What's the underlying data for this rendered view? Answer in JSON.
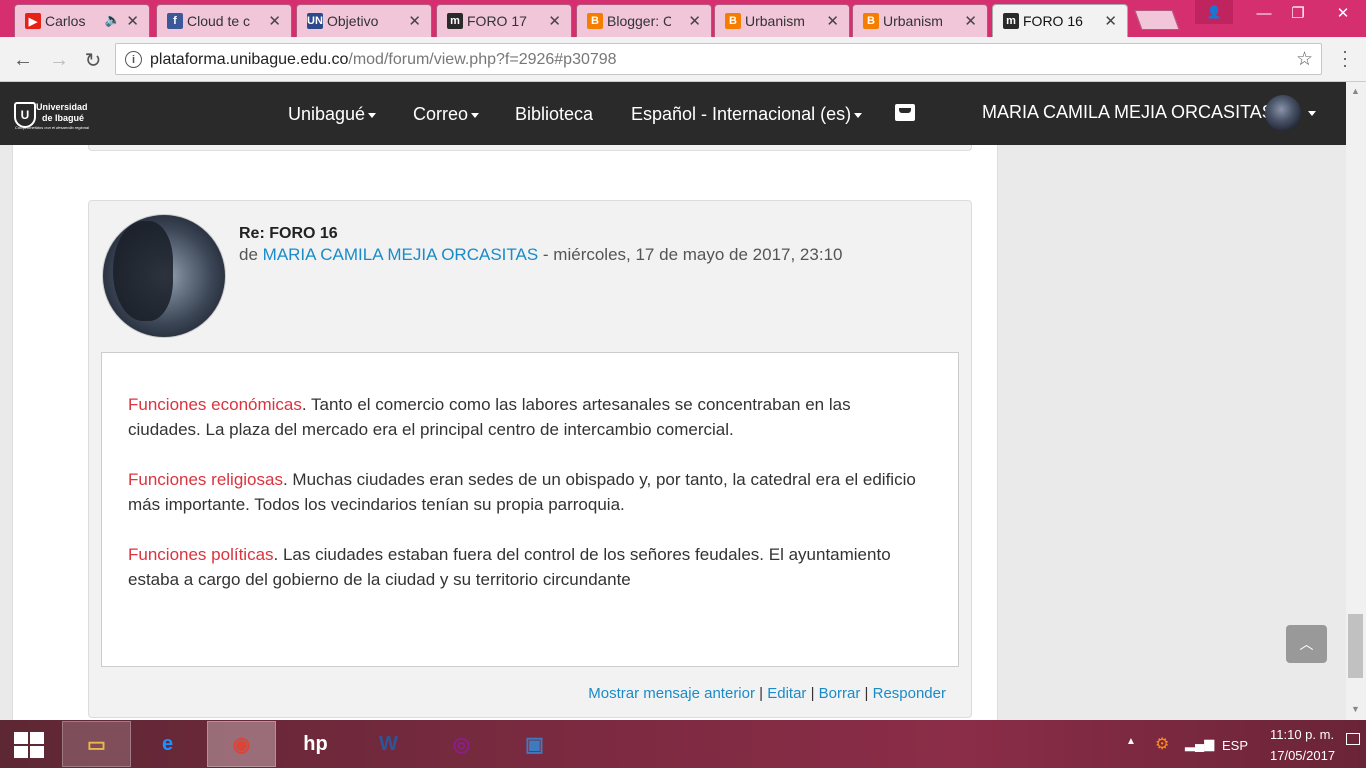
{
  "browser": {
    "tabs": [
      {
        "title": "Carlos",
        "favicon": "youtube-icon",
        "color": "#e62117",
        "glyph": "▶",
        "audio": true
      },
      {
        "title": "Cloud te c",
        "favicon": "facebook-icon",
        "color": "#3b5998",
        "glyph": "f"
      },
      {
        "title": "Objetivo",
        "favicon": "un-icon",
        "color": "#2c4a8a",
        "glyph": "UN"
      },
      {
        "title": "FORO 17",
        "favicon": "moodle-icon",
        "color": "#2a2a2a",
        "glyph": "m"
      },
      {
        "title": "Blogger: C",
        "favicon": "blogger-icon",
        "color": "#f57d00",
        "glyph": "B"
      },
      {
        "title": "Urbanism",
        "favicon": "blogger-icon",
        "color": "#f57d00",
        "glyph": "B"
      },
      {
        "title": "Urbanism",
        "favicon": "blogger-icon",
        "color": "#f57d00",
        "glyph": "B"
      },
      {
        "title": "FORO 16",
        "favicon": "moodle-icon",
        "color": "#2a2a2a",
        "glyph": "m",
        "active": true
      }
    ],
    "close_glyph": "✕",
    "url_host": "plataforma.unibague.edu.co",
    "url_path": "/mod/forum/view.php?f=2926#p30798",
    "back_icon": "←",
    "forward_icon": "→",
    "reload_icon": "↻",
    "star_icon": "☆",
    "min_icon": "—",
    "max_icon": "❐",
    "close_icon": "✕"
  },
  "site": {
    "logo_line1": "Universidad",
    "logo_line2": "de Ibagué",
    "logo_tagline": "Comprometidos con el desarrollo regional",
    "nav": {
      "unibague": "Unibagué",
      "correo": "Correo",
      "biblioteca": "Biblioteca",
      "language": "Español - Internacional (es)"
    },
    "user_name": "MARIA CAMILA MEJIA ORCASITAS"
  },
  "post": {
    "subject": "Re: FORO 16",
    "by_prefix": "de",
    "author": "MARIA CAMILA MEJIA ORCASITAS",
    "date": " - miércoles, 17 de mayo de 2017, 23:10",
    "paragraphs": [
      {
        "heading": "Funciones económicas",
        "text": ". Tanto el comercio como las labores artesanales se concentraban en las ciudades. La plaza del mercado era el principal centro de intercambio comercial."
      },
      {
        "heading": "Funciones religiosas",
        "text": ". Muchas ciudades eran sedes de un obispado y, por tanto, la catedral era el edificio más importante. Todos los vecindarios tenían su propia parroquia."
      },
      {
        "heading": "Funciones políticas",
        "text": ". Las ciudades estaban fuera del control de los señores feudales. El ayuntamiento estaba a cargo del gobierno de la ciudad y su territorio circundante"
      }
    ],
    "commands": {
      "show_parent": "Mostrar mensaje anterior",
      "edit": "Editar",
      "delete": "Borrar",
      "reply": "Responder",
      "separator": "|"
    },
    "accent_color": "#d9343f",
    "link_color": "#1a8bc8"
  },
  "taskbar": {
    "apps": [
      {
        "name": "file-explorer",
        "glyph": "▭",
        "color": "#e8b84a"
      },
      {
        "name": "internet-explorer",
        "glyph": "e",
        "color": "#1e90ff"
      },
      {
        "name": "chrome",
        "glyph": "◉",
        "color": "#db4437"
      },
      {
        "name": "hp",
        "glyph": "hp",
        "color": "#ffffff"
      },
      {
        "name": "word",
        "glyph": "W",
        "color": "#2b579a"
      },
      {
        "name": "camera",
        "glyph": "◎",
        "color": "#8a1e8a"
      },
      {
        "name": "photos",
        "glyph": "▣",
        "color": "#3c7bbf"
      }
    ],
    "language": "ESP",
    "time": "11:10 p. m.",
    "date": "17/05/2017"
  }
}
